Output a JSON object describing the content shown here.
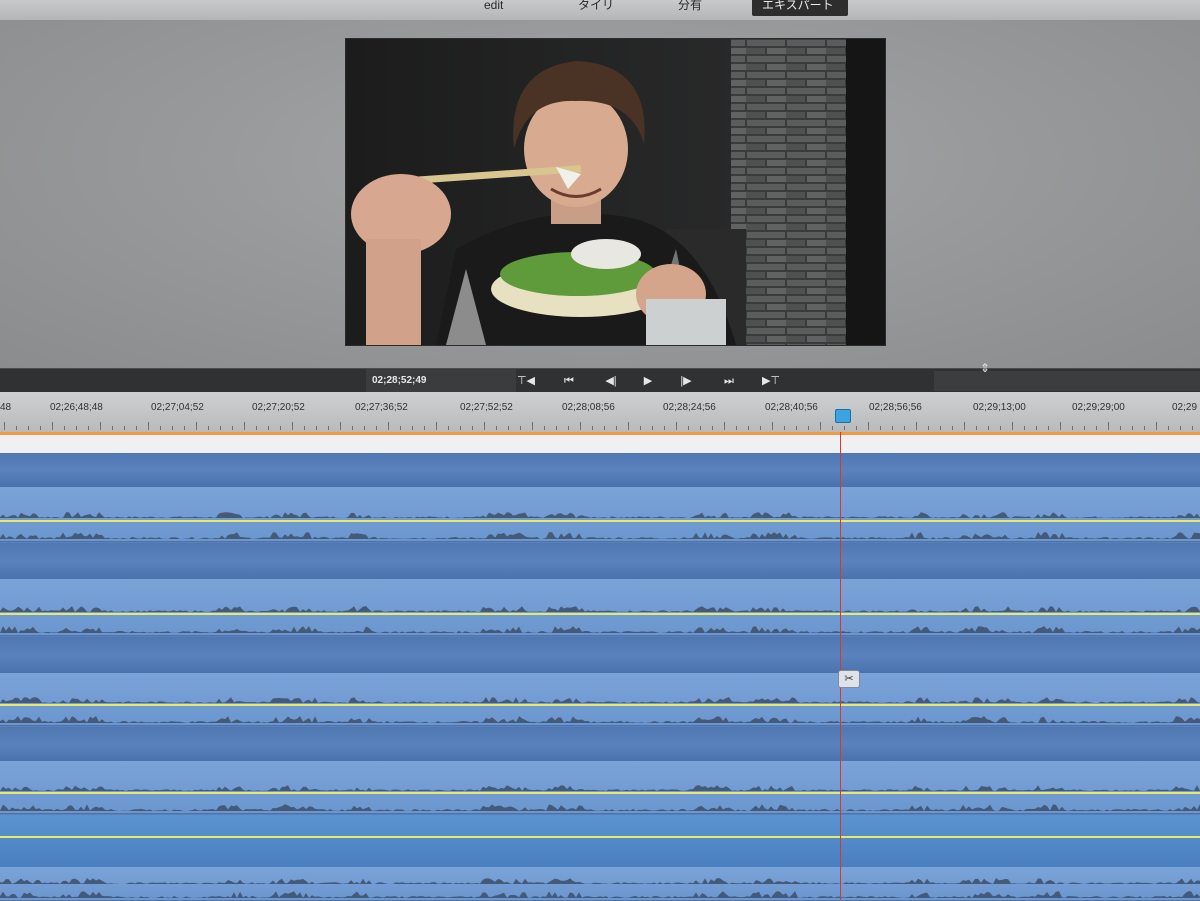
{
  "mode_tabs": [
    {
      "label": "edit"
    },
    {
      "label": "タイリ"
    },
    {
      "label": "分有"
    },
    {
      "label": "エキスパート"
    }
  ],
  "transport": {
    "timecode": "02;28;52;49",
    "buttons": [
      {
        "name": "mark-in",
        "glyph": "⊤◀"
      },
      {
        "name": "go-to-start",
        "glyph": "⏮"
      },
      {
        "name": "step-back",
        "glyph": "◀|"
      },
      {
        "name": "play",
        "glyph": "▶"
      },
      {
        "name": "step-forward",
        "glyph": "|▶"
      },
      {
        "name": "go-to-end",
        "glyph": "⏭"
      },
      {
        "name": "mark-out",
        "glyph": "▶⊤"
      }
    ]
  },
  "ruler": {
    "labels": [
      "48",
      "02;26;48;48",
      "02;27;04;52",
      "02;27;20;52",
      "02;27;36;52",
      "02;27;52;52",
      "02;28;08;56",
      "02;28;24;56",
      "02;28;40;56",
      "02;28;56;56",
      "02;29;13;00",
      "02;29;29;00",
      "02;29"
    ]
  },
  "colors": {
    "playhead": "#e0332b",
    "volume_line": "#e6e96a",
    "video_track": "#4f78b3",
    "audio_track": "#7aa3d8",
    "ruler_marker": "#3aa4e0"
  }
}
